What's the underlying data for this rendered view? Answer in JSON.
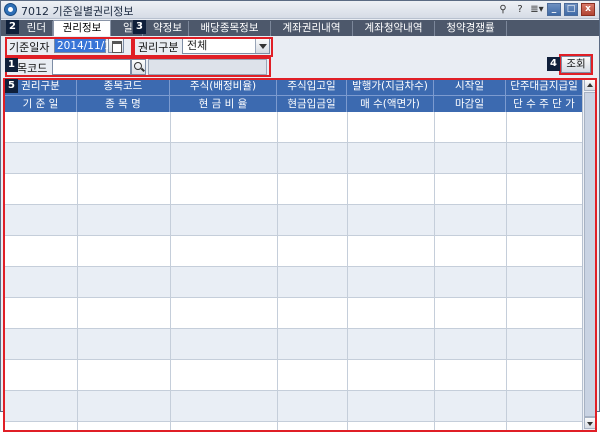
{
  "window": {
    "title": "7012 기준일별권리정보",
    "tools": [
      "⚲",
      "?",
      "≣▾"
    ],
    "buttons": {
      "minimize": "_",
      "maximize": "□",
      "close": "x"
    }
  },
  "tabs": [
    {
      "label": "권리캘린더",
      "visible_text": "린더"
    },
    {
      "label": "권리정보",
      "active": true
    },
    {
      "label": "일정정보",
      "visible_text": "일"
    },
    {
      "label": "배정약정보",
      "visible_text": "약정보"
    },
    {
      "label": "배당종목정보"
    },
    {
      "label": "계좌권리내역"
    },
    {
      "label": "계좌청약내역"
    },
    {
      "label": "청약경쟁률"
    }
  ],
  "filters": {
    "date_label": "기준일자",
    "date_value": "2014/11/11",
    "right_type_label": "권리구분",
    "right_type_value": "전체",
    "code_label": "종목코드",
    "code_label_visible": "목코드",
    "code_value": "",
    "name_value": ""
  },
  "query_button": "조회",
  "markers": [
    "1",
    "2",
    "3",
    "4",
    "5"
  ],
  "grid": {
    "headers_row1": [
      "권리구분",
      "종목코드",
      "주식(배정비율)",
      "주식입고일",
      "발행가(지급차수)",
      "시작일",
      "단주대금지급일"
    ],
    "headers_row2": [
      "기 준 일",
      "종 목 명",
      "현 금 비 율",
      "현금입금일",
      "매   수(액면가)",
      "마감일",
      "단 수 주 단 가"
    ],
    "row_count": 9
  },
  "colors": {
    "header_bg": "#3c6ab0",
    "highlight": "#e01f26",
    "tab_bar": "#4d586b",
    "selected_date_bg": "#3875d7"
  }
}
